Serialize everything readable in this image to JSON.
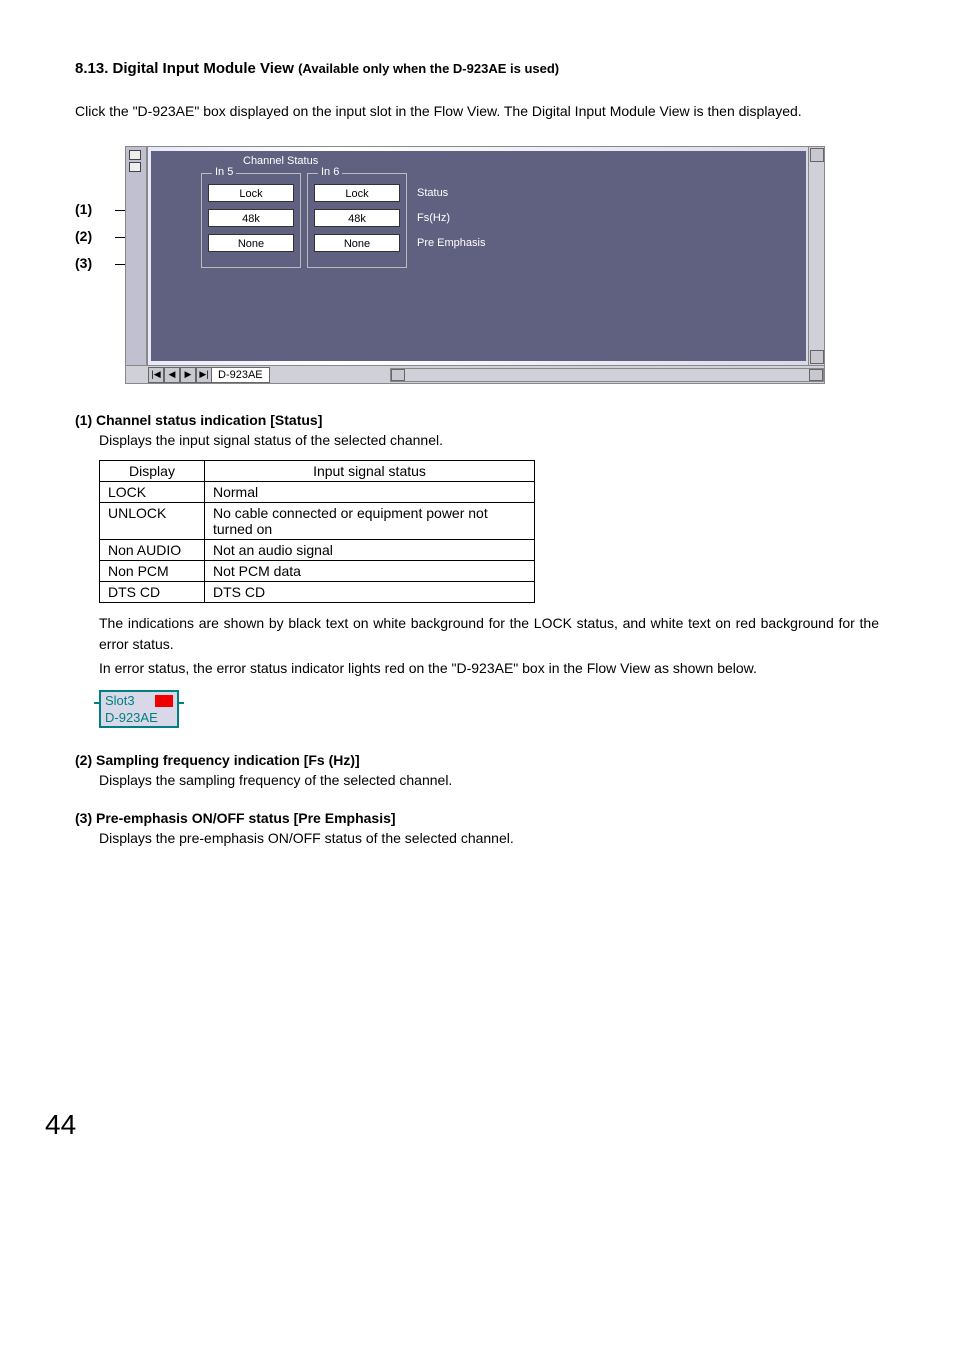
{
  "heading": {
    "title": "8.13. Digital Input Module View",
    "subtitle": "(Available only when the D-923AE is used)"
  },
  "intro": "Click the \"D-923AE\" box displayed on the input slot in the Flow View. The Digital Input Module View is then displayed.",
  "callouts": [
    "(1)",
    "(2)",
    "(3)"
  ],
  "shot": {
    "panel_title": "Channel Status",
    "groups": [
      {
        "label": "In 5",
        "values": [
          "Lock",
          "48k",
          "None"
        ]
      },
      {
        "label": "In 6",
        "values": [
          "Lock",
          "48k",
          "None"
        ]
      }
    ],
    "row_labels": [
      "Status",
      "Fs(Hz)",
      "Pre Emphasis"
    ],
    "tab_name": "D-923AE",
    "tab_buttons": [
      "|◀",
      "◀",
      "▶",
      "▶|"
    ]
  },
  "sections": {
    "s1": {
      "title": "(1) Channel status indication [Status]",
      "desc": "Displays the input signal status of the selected channel.",
      "table": {
        "headers": [
          "Display",
          "Input signal status"
        ],
        "rows": [
          [
            "LOCK",
            "Normal"
          ],
          [
            "UNLOCK",
            "No cable connected or equipment power not turned on"
          ],
          [
            "Non AUDIO",
            "Not an audio signal"
          ],
          [
            "Non PCM",
            "Not PCM data"
          ],
          [
            "DTS CD",
            "DTS CD"
          ]
        ]
      },
      "after1": "The indications are shown by black text on white background for the LOCK status, and white text on red background for the error status.",
      "after2": "In error status, the error status indicator lights red on the \"D-923AE\" box in the Flow View as shown below."
    },
    "slot": {
      "line1": "Slot3",
      "line2": "D-923AE"
    },
    "s2": {
      "title": "(2) Sampling frequency indication [Fs (Hz)]",
      "desc": "Displays the sampling frequency of the selected channel."
    },
    "s3": {
      "title": "(3) Pre-emphasis ON/OFF status [Pre Emphasis]",
      "desc": "Displays the pre-emphasis ON/OFF status of the selected channel."
    }
  },
  "page_number": "44"
}
